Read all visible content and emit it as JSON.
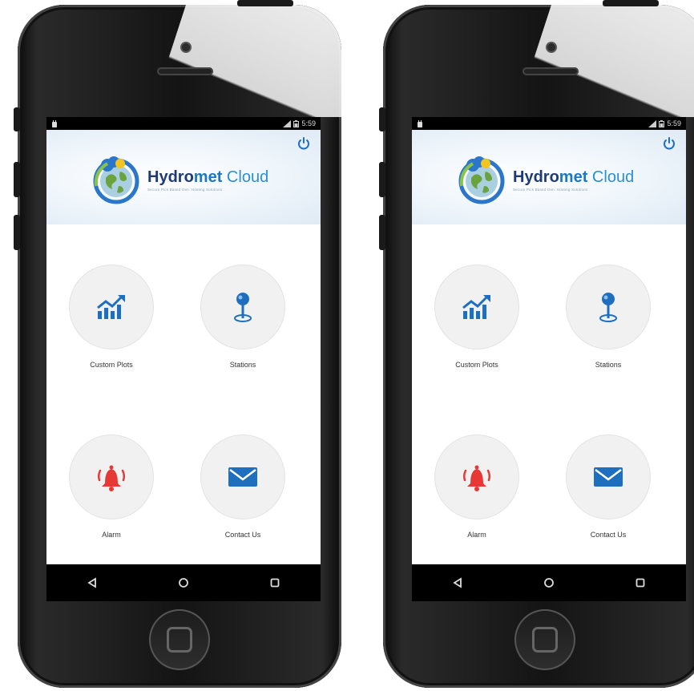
{
  "phones": [
    {
      "status_time": "5:59",
      "app": {
        "brand_part1": "Hydro",
        "brand_part2": "met",
        "brand_part3": " Cloud",
        "tagline": "Secure Pick Based Gen. Hosting Solutions"
      },
      "tiles": [
        {
          "label": "Custom Plots",
          "icon": "chart-icon"
        },
        {
          "label": "Stations",
          "icon": "map-pin-icon"
        },
        {
          "label": "Alarm",
          "icon": "bell-icon"
        },
        {
          "label": "Contact Us",
          "icon": "mail-icon"
        }
      ]
    },
    {
      "status_time": "5:59",
      "app": {
        "brand_part1": "Hydro",
        "brand_part2": "met",
        "brand_part3": " Cloud",
        "tagline": "Secure Pick Based Gen. Hosting Solutions"
      },
      "tiles": [
        {
          "label": "Custom Plots",
          "icon": "chart-icon"
        },
        {
          "label": "Stations",
          "icon": "map-pin-icon"
        },
        {
          "label": "Alarm",
          "icon": "bell-icon"
        },
        {
          "label": "Contact Us",
          "icon": "mail-icon"
        }
      ]
    }
  ],
  "colors": {
    "accent_blue": "#1e6fc0",
    "alarm_red": "#e63935",
    "brand_dark": "#1f3b73"
  }
}
